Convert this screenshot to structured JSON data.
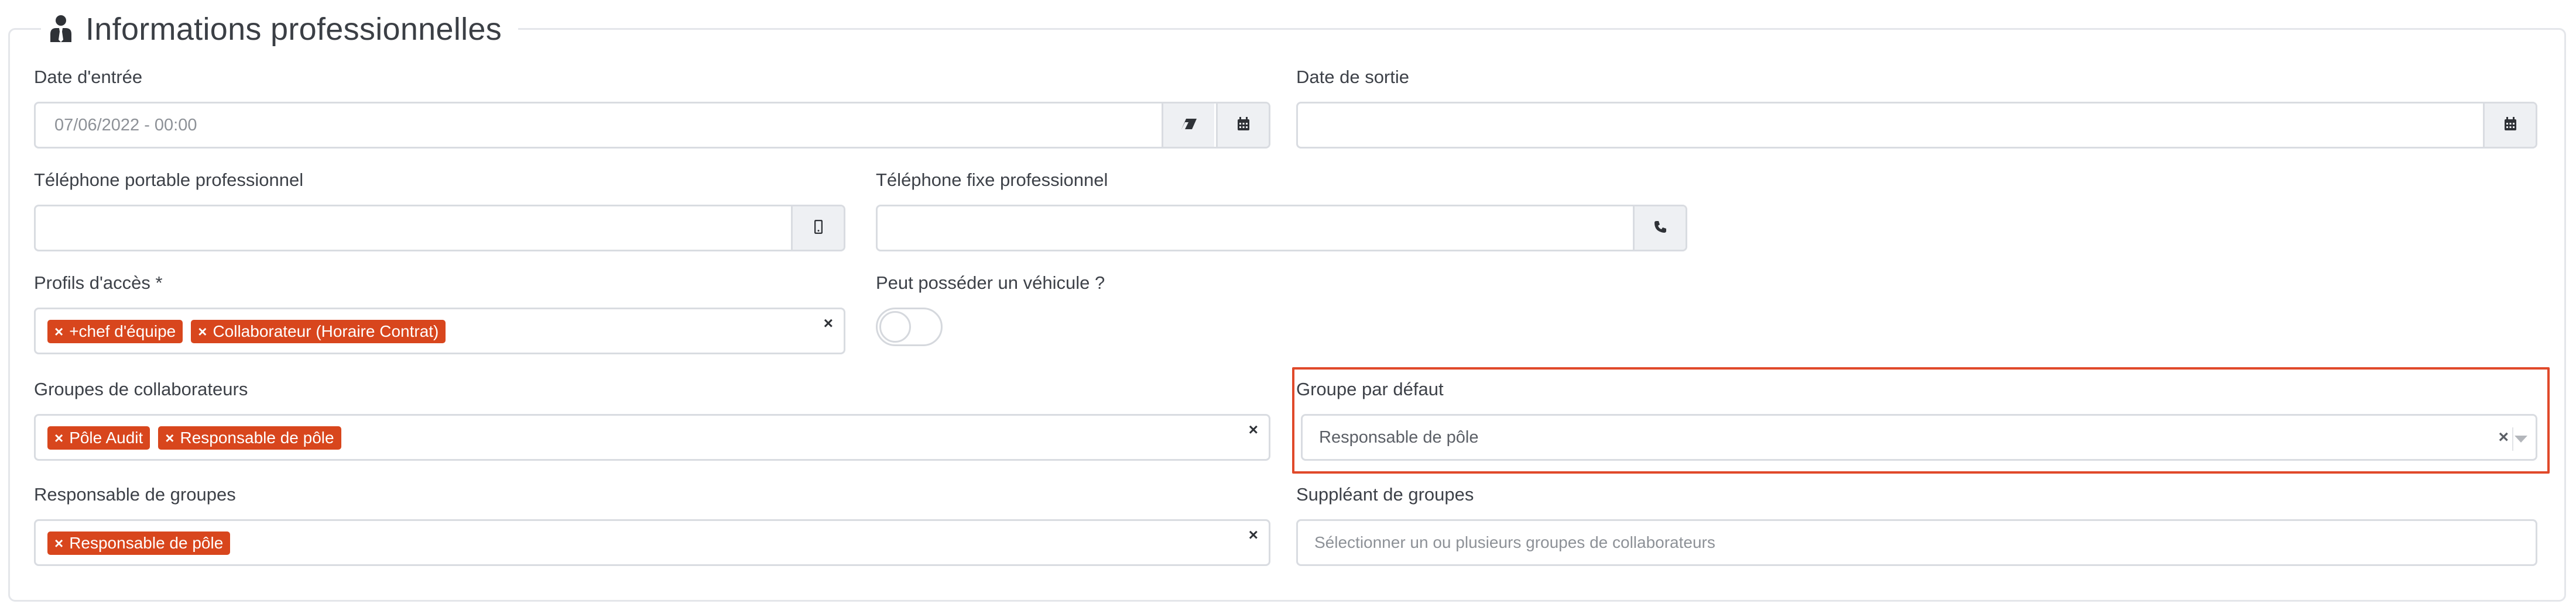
{
  "section": {
    "title": "Informations professionnelles",
    "icon": "user-tie-icon"
  },
  "fields": {
    "date_entree": {
      "label": "Date d'entrée",
      "value": "07/06/2022 - 00:00",
      "icons": [
        "eraser-icon",
        "calendar-icon"
      ]
    },
    "date_sortie": {
      "label": "Date de sortie",
      "value": "",
      "icons": [
        "calendar-icon"
      ]
    },
    "tel_portable": {
      "label": "Téléphone portable professionnel",
      "value": "",
      "icons": [
        "mobile-icon"
      ]
    },
    "tel_fixe": {
      "label": "Téléphone fixe professionnel",
      "value": "",
      "icons": [
        "phone-icon"
      ]
    },
    "profils": {
      "label": "Profils d'accès *",
      "tags": [
        "+chef d'équipe",
        "Collaborateur (Horaire Contrat)"
      ],
      "clear": "×"
    },
    "vehicule": {
      "label": "Peut posséder un véhicule ?",
      "checked": false
    },
    "groupes": {
      "label": "Groupes de collaborateurs",
      "tags": [
        "Pôle Audit",
        "Responsable de pôle"
      ],
      "clear": "×"
    },
    "groupe_defaut": {
      "label": "Groupe par défaut",
      "value": "Responsable de pôle",
      "clear": "×"
    },
    "responsable": {
      "label": "Responsable de groupes",
      "tags": [
        "Responsable de pôle"
      ],
      "clear": "×"
    },
    "suppleant": {
      "label": "Suppléant de groupes",
      "placeholder": "Sélectionner un ou plusieurs groupes de collaborateurs"
    }
  },
  "tag_remove_glyph": "×",
  "colors": {
    "tag_bg": "#d8461d",
    "highlight_border": "#e0492a",
    "addon_bg": "#eef0f3",
    "border": "#d9dce1"
  }
}
